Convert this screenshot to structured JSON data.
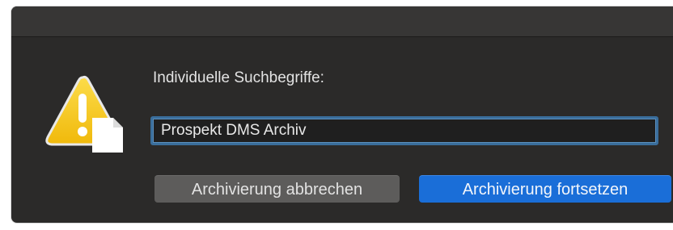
{
  "dialog": {
    "prompt_label": "Individuelle Suchbegriffe:",
    "search_field": {
      "value": "Prospekt DMS Archiv",
      "placeholder": ""
    },
    "buttons": {
      "cancel_label": "Archivierung abbrechen",
      "continue_label": "Archivierung fortsetzen"
    },
    "icon": "warning-with-document-icon"
  },
  "colors": {
    "window_background": "#2b2a29",
    "titlebar": "#373635",
    "text": "#e3e3e3",
    "field_border": "#3a6e9c",
    "cancel_button": "#5d5c5b",
    "accent_button": "#1a6ed8",
    "warning_yellow": "#f5c516"
  }
}
